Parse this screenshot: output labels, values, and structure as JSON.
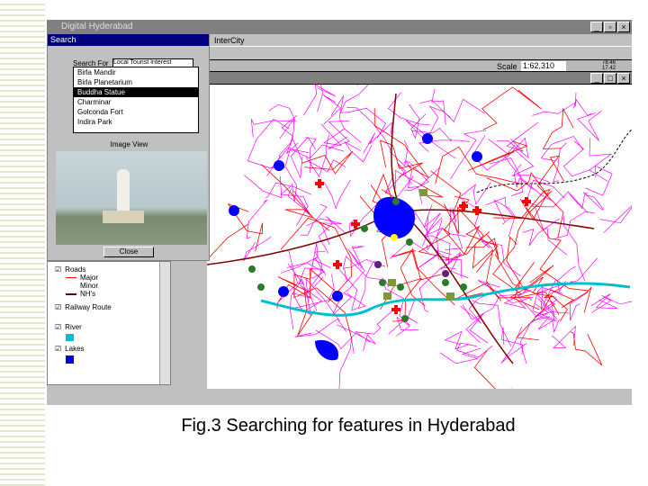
{
  "window": {
    "title": "Digital Hyderabad",
    "menu": [
      "InterCity"
    ],
    "scale_label": "Scale",
    "scale_value": "1:62,310",
    "coords": "78.46\n17.42"
  },
  "search": {
    "title": "Search",
    "search_for_label": "Search For",
    "search_for_value": "Local Tourist Interest",
    "items": [
      "Birla Mandir",
      "Birla Planetarium",
      "Buddha Statue",
      "Charminar",
      "Golconda Fort",
      "Indira Park"
    ],
    "selected_index": 2,
    "image_view_label": "Image View",
    "close_label": "Close"
  },
  "legend": {
    "roads": "Roads",
    "major": "Major",
    "minor": "Minor",
    "nh": "NH's",
    "railway": "Railway Route",
    "river": "River",
    "lakes": "Lakes",
    "colors": {
      "major": "#ff0000",
      "minor": "#ff00ff",
      "nh": "#800000",
      "river": "#00c0d0",
      "lakes": "#0000ff"
    }
  },
  "caption": "Fig.3 Searching for features in Hyderabad"
}
